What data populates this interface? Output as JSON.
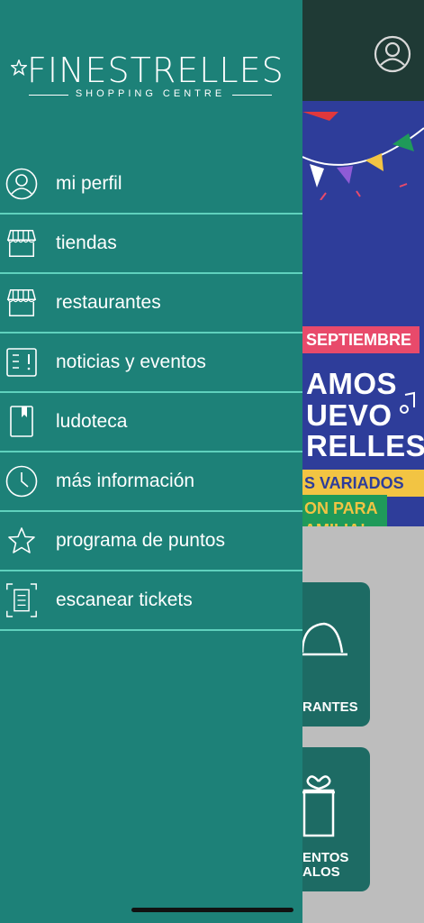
{
  "brand": {
    "title": "FINESTRELLES",
    "subtitle": "SHOPPING CENTRE"
  },
  "menu": {
    "items": [
      {
        "label": "mi perfil",
        "icon": "profile-icon"
      },
      {
        "label": "tiendas",
        "icon": "store-icon"
      },
      {
        "label": "restaurantes",
        "icon": "restaurant-icon"
      },
      {
        "label": "noticias y eventos",
        "icon": "news-icon"
      },
      {
        "label": "ludoteca",
        "icon": "book-icon"
      },
      {
        "label": "más información",
        "icon": "clock-icon"
      },
      {
        "label": "programa de puntos",
        "icon": "star-icon"
      },
      {
        "label": "escanear tickets",
        "icon": "scan-ticket-icon"
      }
    ]
  },
  "background": {
    "banner": {
      "ribbon": "SEPTIEMBRE",
      "line1": "AMOS",
      "line2": "UEVO",
      "line3": "RELLES",
      "yellow": "S VARIADOS",
      "green1": "ON PARA",
      "green2": "AMILIA!"
    },
    "cards": [
      {
        "label": "RANTES"
      },
      {
        "label": "ENTOS\nALOS"
      }
    ]
  },
  "colors": {
    "drawer": "#1d8178",
    "divider": "#5fd1bd",
    "banner": "#2e3d9a",
    "ribbon": "#e84a6b",
    "card": "#1d6b64"
  }
}
